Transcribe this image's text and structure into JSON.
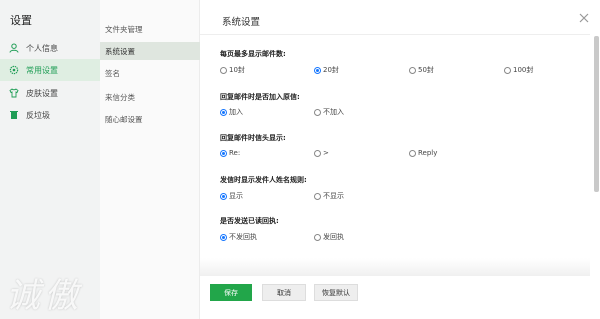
{
  "left_nav": {
    "title": "设置",
    "items": [
      {
        "label": "个人信息",
        "icon": "user-icon"
      },
      {
        "label": "常用设置",
        "icon": "gear-icon"
      },
      {
        "label": "皮肤设置",
        "icon": "shirt-icon"
      },
      {
        "label": "反垃圾",
        "icon": "trash-icon"
      }
    ]
  },
  "sub_nav": {
    "items": [
      {
        "label": "文件夹管理"
      },
      {
        "label": "系统设置"
      },
      {
        "label": "签名"
      },
      {
        "label": "来信分类"
      },
      {
        "label": "随心邮设置"
      }
    ]
  },
  "main": {
    "title": "系统设置",
    "settings": [
      {
        "label": "每页最多显示邮件数:",
        "options": [
          "10封",
          "20封",
          "50封",
          "100封"
        ],
        "selected": 1
      },
      {
        "label": "回复邮件时是否加入原信:",
        "options": [
          "加入",
          "不加入"
        ],
        "selected": 0
      },
      {
        "label": "回复邮件时信头显示:",
        "options": [
          "Re:",
          ">",
          "Reply"
        ],
        "selected": 0
      },
      {
        "label": "发信时显示发件人姓名规则:",
        "options": [
          "显示",
          "不显示"
        ],
        "selected": 0
      },
      {
        "label": "是否发送已读回执:",
        "options": [
          "不发回执",
          "发回执"
        ],
        "selected": 0
      }
    ]
  },
  "buttons": {
    "save": "保存",
    "cancel": "取消",
    "reset": "恢复默认"
  },
  "watermark": "诚傲",
  "colors": {
    "accent": "#22a64a",
    "radio_checked": "#1677ff",
    "active_nav_bg": "#dfeee2"
  }
}
